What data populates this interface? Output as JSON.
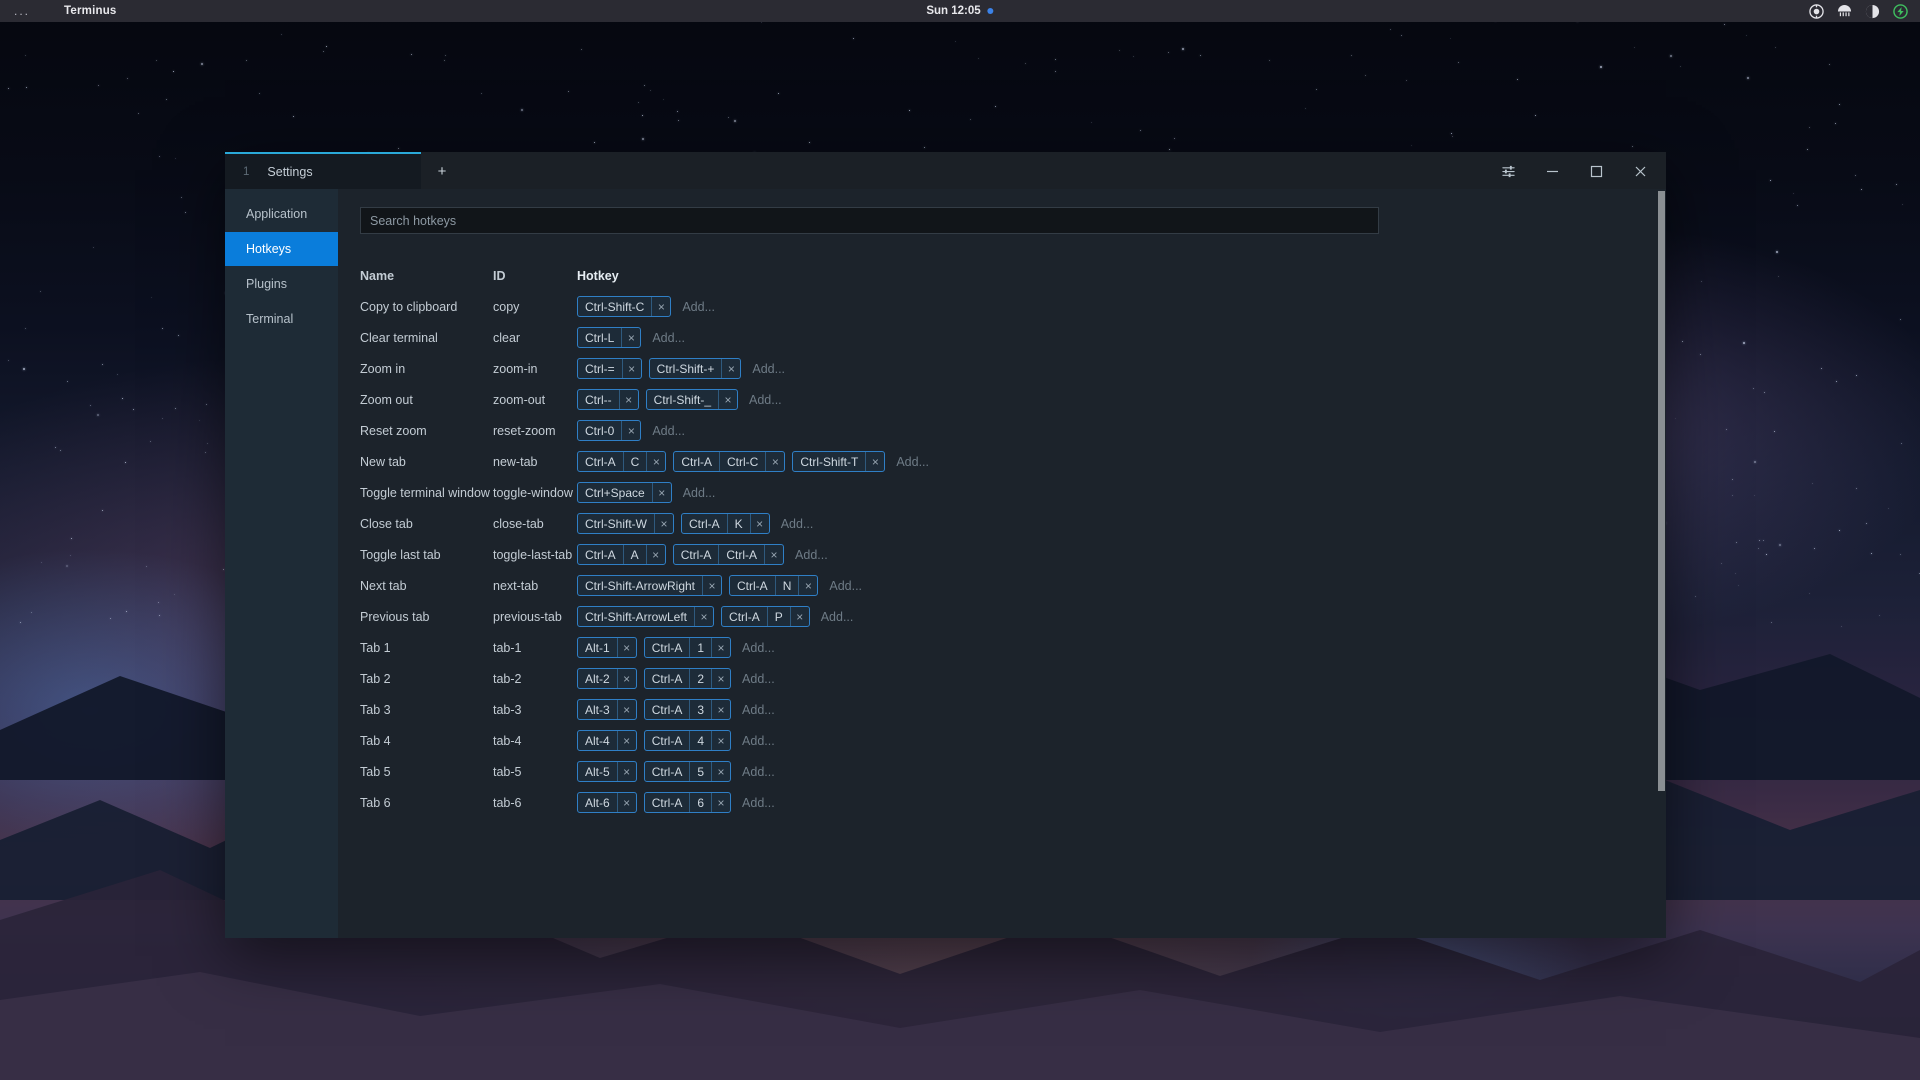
{
  "topbar": {
    "overview_label": "...",
    "app_title": "Terminus",
    "clock": "Sun 12:05",
    "tray": [
      "location-icon",
      "network-icon",
      "volume-icon",
      "power-icon"
    ]
  },
  "window": {
    "tab": {
      "number": "1",
      "title": "Settings"
    },
    "new_tab_label": "+",
    "controls": {
      "settings_label": "sliders-icon",
      "minimize_label": "minimize-icon",
      "maximize_label": "maximize-icon",
      "close_label": "close-icon"
    },
    "accent_color": "#2aa9d8"
  },
  "sidebar": {
    "items": [
      {
        "label": "Application",
        "active": false
      },
      {
        "label": "Hotkeys",
        "active": true
      },
      {
        "label": "Plugins",
        "active": false
      },
      {
        "label": "Terminal",
        "active": false
      }
    ],
    "active_color": "#0a7ddb"
  },
  "search": {
    "value": "",
    "placeholder": "Search hotkeys"
  },
  "table": {
    "headers": {
      "name": "Name",
      "id": "ID",
      "hotkey": "Hotkey"
    },
    "add_label": "Add...",
    "remove_label": "×",
    "rows": [
      {
        "name": "Copy to clipboard",
        "id": "copy",
        "chips": [
          [
            "Ctrl-Shift-C"
          ]
        ]
      },
      {
        "name": "Clear terminal",
        "id": "clear",
        "chips": [
          [
            "Ctrl-L"
          ]
        ]
      },
      {
        "name": "Zoom in",
        "id": "zoom-in",
        "chips": [
          [
            "Ctrl-="
          ],
          [
            "Ctrl-Shift-+"
          ]
        ]
      },
      {
        "name": "Zoom out",
        "id": "zoom-out",
        "chips": [
          [
            "Ctrl--"
          ],
          [
            "Ctrl-Shift-_"
          ]
        ]
      },
      {
        "name": "Reset zoom",
        "id": "reset-zoom",
        "chips": [
          [
            "Ctrl-0"
          ]
        ]
      },
      {
        "name": "New tab",
        "id": "new-tab",
        "chips": [
          [
            "Ctrl-A",
            "C"
          ],
          [
            "Ctrl-A",
            "Ctrl-C"
          ],
          [
            "Ctrl-Shift-T"
          ]
        ]
      },
      {
        "name": "Toggle terminal window",
        "id": "toggle-window",
        "chips": [
          [
            "Ctrl+Space"
          ]
        ]
      },
      {
        "name": "Close tab",
        "id": "close-tab",
        "chips": [
          [
            "Ctrl-Shift-W"
          ],
          [
            "Ctrl-A",
            "K"
          ]
        ]
      },
      {
        "name": "Toggle last tab",
        "id": "toggle-last-tab",
        "chips": [
          [
            "Ctrl-A",
            "A"
          ],
          [
            "Ctrl-A",
            "Ctrl-A"
          ]
        ]
      },
      {
        "name": "Next tab",
        "id": "next-tab",
        "chips": [
          [
            "Ctrl-Shift-ArrowRight"
          ],
          [
            "Ctrl-A",
            "N"
          ]
        ]
      },
      {
        "name": "Previous tab",
        "id": "previous-tab",
        "chips": [
          [
            "Ctrl-Shift-ArrowLeft"
          ],
          [
            "Ctrl-A",
            "P"
          ]
        ]
      },
      {
        "name": "Tab 1",
        "id": "tab-1",
        "chips": [
          [
            "Alt-1"
          ],
          [
            "Ctrl-A",
            "1"
          ]
        ]
      },
      {
        "name": "Tab 2",
        "id": "tab-2",
        "chips": [
          [
            "Alt-2"
          ],
          [
            "Ctrl-A",
            "2"
          ]
        ]
      },
      {
        "name": "Tab 3",
        "id": "tab-3",
        "chips": [
          [
            "Alt-3"
          ],
          [
            "Ctrl-A",
            "3"
          ]
        ]
      },
      {
        "name": "Tab 4",
        "id": "tab-4",
        "chips": [
          [
            "Alt-4"
          ],
          [
            "Ctrl-A",
            "4"
          ]
        ]
      },
      {
        "name": "Tab 5",
        "id": "tab-5",
        "chips": [
          [
            "Alt-5"
          ],
          [
            "Ctrl-A",
            "5"
          ]
        ]
      },
      {
        "name": "Tab 6",
        "id": "tab-6",
        "chips": [
          [
            "Alt-6"
          ],
          [
            "Ctrl-A",
            "6"
          ]
        ]
      }
    ]
  }
}
